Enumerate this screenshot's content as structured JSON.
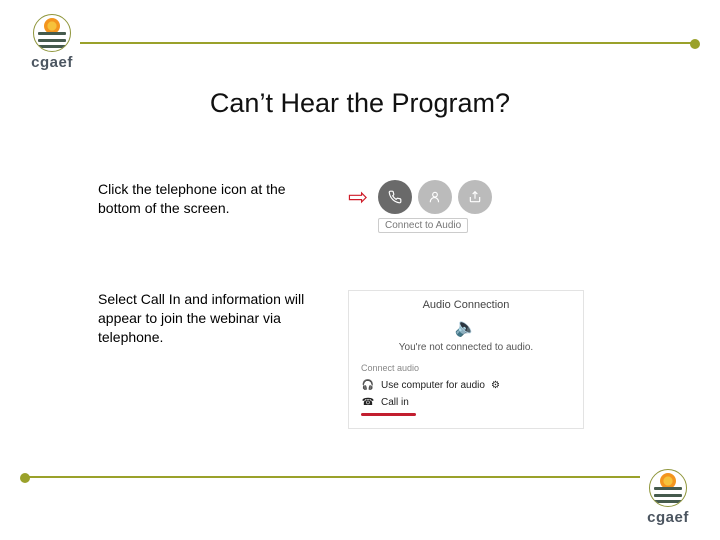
{
  "brand": {
    "name": "cgaef"
  },
  "title": "Can’t Hear the Program?",
  "instructions": [
    "Click the telephone icon at the bottom of the screen.",
    "Select Call In and information will appear to join the webinar via telephone."
  ],
  "shot1": {
    "connect_label": "Connect to Audio"
  },
  "shot2": {
    "dialog_title": "Audio Connection",
    "message": "You're not connected to audio.",
    "section": "Connect audio",
    "option1": "Use computer for audio",
    "option2": "Call in"
  }
}
